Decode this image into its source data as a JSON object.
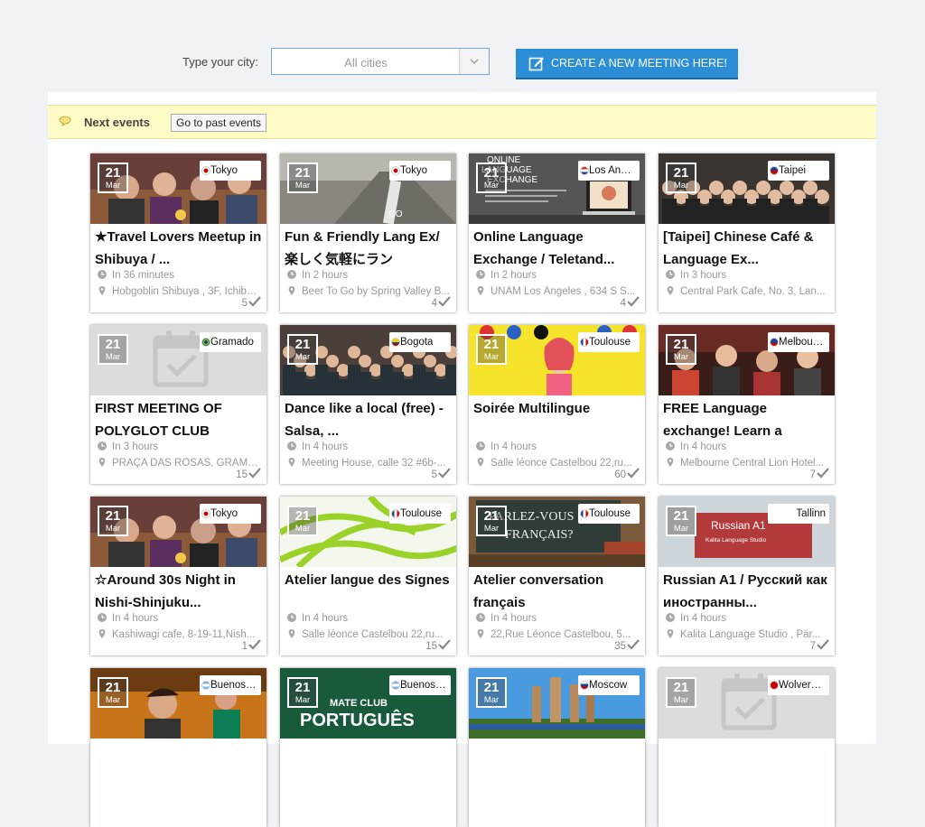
{
  "search": {
    "label": "Type your city:",
    "placeholder": "All cities",
    "create_button": "CREATE A NEW MEETING HERE!"
  },
  "next_bar": {
    "title": "Next events",
    "past_button": "Go to past events"
  },
  "colors": {
    "accent": "#2c8ed6",
    "highlight": "#fdfcc6"
  },
  "events": [
    {
      "day": "21",
      "month": "Mar",
      "city": "Tokyo",
      "title": "★Travel Lovers Meetup in Shibuya / ...",
      "time": "In 36 minutes",
      "location": "Hobgoblin Shibuya , 3F, Ichiba...",
      "count": "5",
      "image": "bar-crowd"
    },
    {
      "day": "21",
      "month": "Mar",
      "city": "Tokyo",
      "title": "Fun & Friendly Lang Ex/楽しく気軽にラン",
      "time": "In 2 hours",
      "location": "Beer To Go by Spring Valley B...",
      "count": "4",
      "image": "street-sign"
    },
    {
      "day": "21",
      "month": "Mar",
      "city": "Los Angeles",
      "title": "Online Language Exchange / Teletand...",
      "time": "In 2 hours",
      "location": "UNAM Los Ángeles , 634 S S...",
      "count": "4",
      "image": "online-flyer"
    },
    {
      "day": "21",
      "month": "Mar",
      "city": "Taipei",
      "title": "[Taipei] Chinese Café & Language Ex...",
      "time": "In 3 hours",
      "location": "Central Park Cafe, No. 3, Lan...",
      "count": "",
      "image": "group-photo"
    },
    {
      "day": "21",
      "month": "Mar",
      "city": "Gramado",
      "title": "FIRST MEETING OF POLYGLOT CLUB",
      "time": "In 3 hours",
      "location": "PRAÇA DAS ROSAS, GRAMA...",
      "count": "15",
      "image": "calendar-placeholder"
    },
    {
      "day": "21",
      "month": "Mar",
      "city": "Bogota",
      "title": "Dance like a local (free) - Salsa, ...",
      "time": "In 4 hours",
      "location": "Meeting House, calle 32 #6b-...",
      "count": "5",
      "image": "big-group"
    },
    {
      "day": "21",
      "month": "Mar",
      "city": "Toulouse",
      "title": "Soirée Multilingue",
      "time": "In 4 hours",
      "location": "Salle léonce Castelbou 22,ru...",
      "count": "60",
      "image": "yellow-flags"
    },
    {
      "day": "21",
      "month": "Mar",
      "city": "Melbourne",
      "title": "FREE Language exchange! Learn a",
      "time": "In 4 hours",
      "location": "Melbourne Central Lion Hotel...",
      "count": "7",
      "image": "party-red"
    },
    {
      "day": "21",
      "month": "Mar",
      "city": "Tokyo",
      "title": "☆Around 30s Night in Nishi-Shinjuku...",
      "time": "In 4 hours",
      "location": "Kashiwagi cafe, 8-19-11,Nish...",
      "count": "1",
      "image": "bar-crowd"
    },
    {
      "day": "21",
      "month": "Mar",
      "city": "Toulouse",
      "title": "Atelier langue des Signes",
      "time": "In 4 hours",
      "location": "Salle léonce Castelbou 22,ru...",
      "count": "15",
      "image": "green-lines"
    },
    {
      "day": "21",
      "month": "Mar",
      "city": "Toulouse",
      "title": "Atelier conversation français",
      "time": "In 4 hours",
      "location": "22,Rue Léonce Castelbou, 5...",
      "count": "35",
      "image": "chalkboard"
    },
    {
      "day": "21",
      "month": "Mar",
      "city": "Tallinn",
      "title": "Russian A1 / Русский как иностранны...",
      "time": "In 4 hours",
      "location": "Kalita Language Studio , Pär...",
      "count": "7",
      "image": "russian-banner"
    },
    {
      "day": "21",
      "month": "Mar",
      "city": "Buenos Aires",
      "title": "",
      "time": "",
      "location": "",
      "count": "",
      "image": "selfie-crowd"
    },
    {
      "day": "21",
      "month": "Mar",
      "city": "Buenos Aires",
      "title": "",
      "time": "",
      "location": "",
      "count": "",
      "image": "mate-club"
    },
    {
      "day": "21",
      "month": "Mar",
      "city": "Moscow",
      "title": "",
      "time": "",
      "location": "",
      "count": "",
      "image": "cathedral"
    },
    {
      "day": "21",
      "month": "Mar",
      "city": "Wolverhampton",
      "title": "",
      "time": "",
      "location": "",
      "count": "",
      "image": "calendar-placeholder"
    }
  ],
  "image_texts": {
    "online_flyer": [
      "ONLINE",
      "LANGUAGE",
      "EXCHANGE"
    ],
    "russian_banner": [
      "Russian A1",
      "Kalita Language Studio"
    ],
    "chalkboard": [
      "PARLEZ-VOUS",
      "FRANÇAIS?"
    ],
    "mate_club": [
      "MATE CLUB",
      "PORTUGUÊS"
    ]
  }
}
